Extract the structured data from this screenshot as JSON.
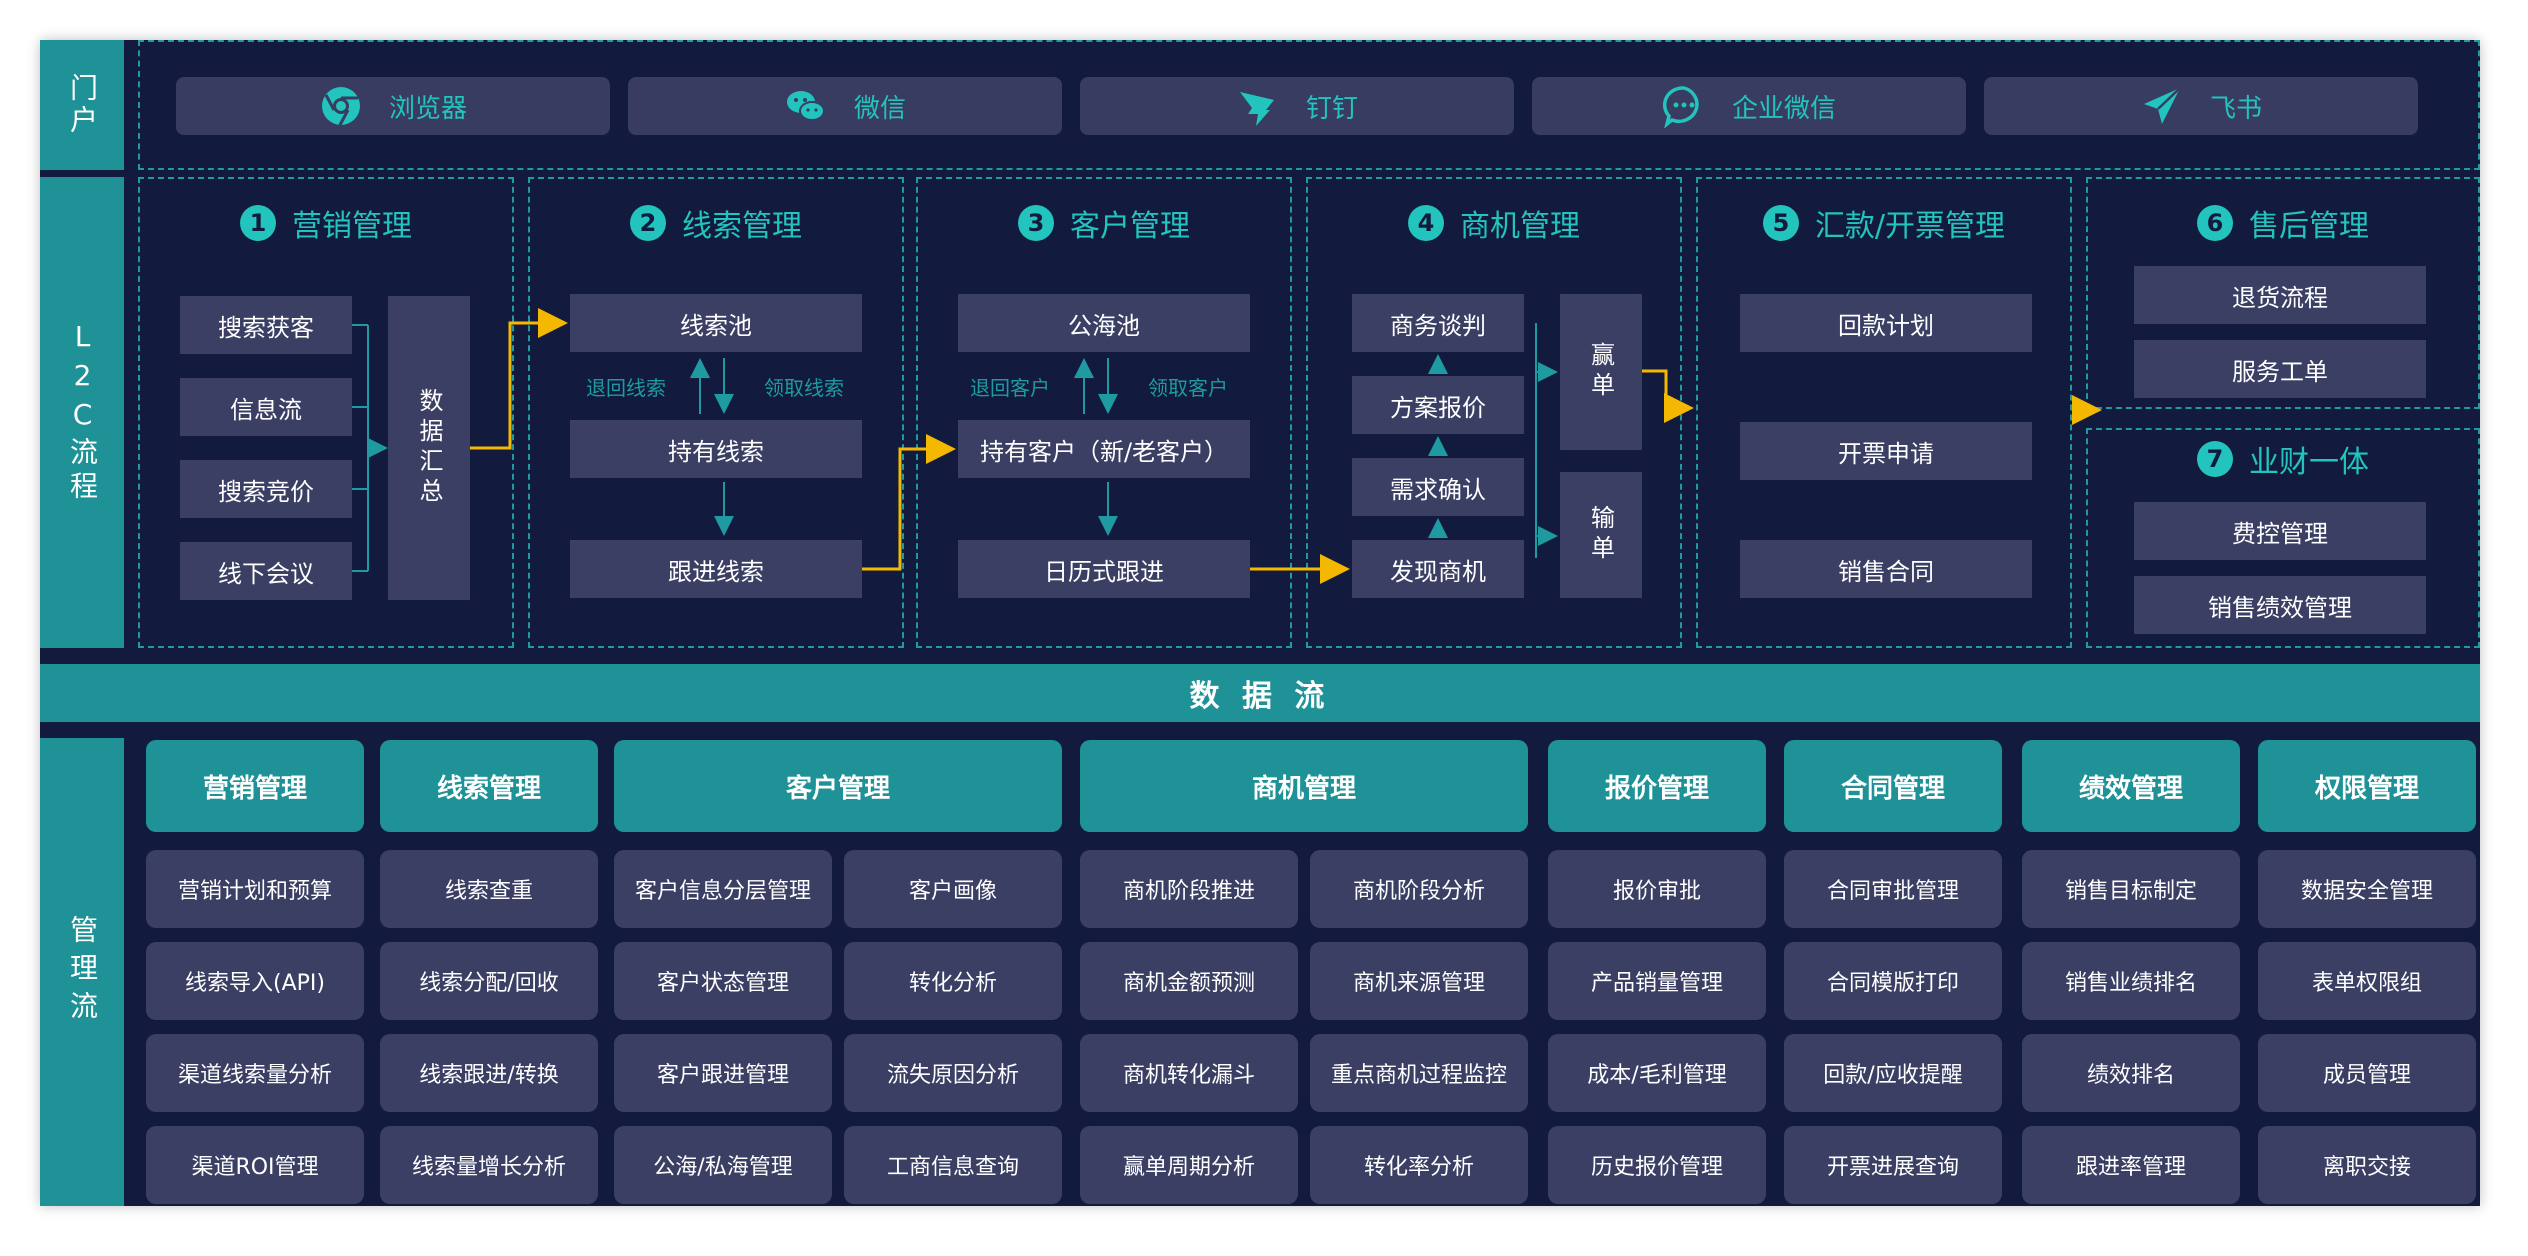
{
  "portal": {
    "side_label": "门户",
    "items": [
      {
        "label": "浏览器",
        "icon": "chrome-icon"
      },
      {
        "label": "微信",
        "icon": "wechat-icon"
      },
      {
        "label": "钉钉",
        "icon": "dingtalk-icon"
      },
      {
        "label": "企业微信",
        "icon": "wecom-icon"
      },
      {
        "label": "飞书",
        "icon": "feishu-icon"
      }
    ]
  },
  "l2c": {
    "side_label": "L2C流程",
    "sections": [
      {
        "num": "1",
        "title": "营销管理"
      },
      {
        "num": "2",
        "title": "线索管理"
      },
      {
        "num": "3",
        "title": "客户管理"
      },
      {
        "num": "4",
        "title": "商机管理"
      },
      {
        "num": "5",
        "title": "汇款/开票管理"
      },
      {
        "num": "6",
        "title": "售后管理"
      },
      {
        "num": "7",
        "title": "业财一体"
      }
    ],
    "marketing": {
      "sources": [
        "搜索获客",
        "信息流",
        "搜索竞价",
        "线下会议"
      ],
      "summary": "数据汇总"
    },
    "leads": {
      "pool": "线索池",
      "held": "持有线索",
      "follow": "跟进线索",
      "return_label": "退回线索",
      "claim_label": "领取线索"
    },
    "customers": {
      "pool": "公海池",
      "held": "持有客户（新/老客户）",
      "calendar": "日历式跟进",
      "return_label": "退回客户",
      "claim_label": "领取客户"
    },
    "opportunities": {
      "stages": [
        "商务谈判",
        "方案报价",
        "需求确认",
        "发现商机"
      ],
      "win": "赢单",
      "lose": "输单"
    },
    "payment": {
      "items": [
        "回款计划",
        "开票申请",
        "销售合同"
      ]
    },
    "aftersales": {
      "items": [
        "退货流程",
        "服务工单"
      ]
    },
    "finance": {
      "items": [
        "费控管理",
        "销售绩效管理"
      ]
    }
  },
  "dataflow": {
    "label": "数 据 流"
  },
  "management": {
    "side_label": "管理流",
    "columns": [
      {
        "header": "营销管理",
        "cells": [
          "营销计划和预算",
          "线索导入(API)",
          "渠道线索量分析",
          "渠道ROI管理"
        ]
      },
      {
        "header": "线索管理",
        "cells": [
          "线索查重",
          "线索分配/回收",
          "线索跟进/转换",
          "线索量增长分析"
        ]
      },
      {
        "header": "客户管理",
        "cells": [
          "客户信息分层管理",
          "客户画像",
          "客户状态管理",
          "转化分析",
          "客户跟进管理",
          "流失原因分析",
          "公海/私海管理",
          "工商信息查询"
        ]
      },
      {
        "header": "商机管理",
        "cells": [
          "商机阶段推进",
          "商机阶段分析",
          "商机金额预测",
          "商机来源管理",
          "商机转化漏斗",
          "重点商机过程监控",
          "赢单周期分析",
          "转化率分析"
        ]
      },
      {
        "header": "报价管理",
        "cells": [
          "报价审批",
          "产品销量管理",
          "成本/毛利管理",
          "历史报价管理"
        ]
      },
      {
        "header": "合同管理",
        "cells": [
          "合同审批管理",
          "合同模版打印",
          "回款/应收提醒",
          "开票进展查询"
        ]
      },
      {
        "header": "绩效管理",
        "cells": [
          "销售目标制定",
          "销售业绩排名",
          "绩效排名",
          "跟进率管理"
        ]
      },
      {
        "header": "权限管理",
        "cells": [
          "数据安全管理",
          "表单权限组",
          "成员管理",
          "离职交接"
        ]
      }
    ]
  },
  "colors": {
    "background": "#121a3e",
    "teal": "#1e9297",
    "accent": "#22c4bd",
    "box": "#3b3f64",
    "arrow": "#f5b800"
  }
}
